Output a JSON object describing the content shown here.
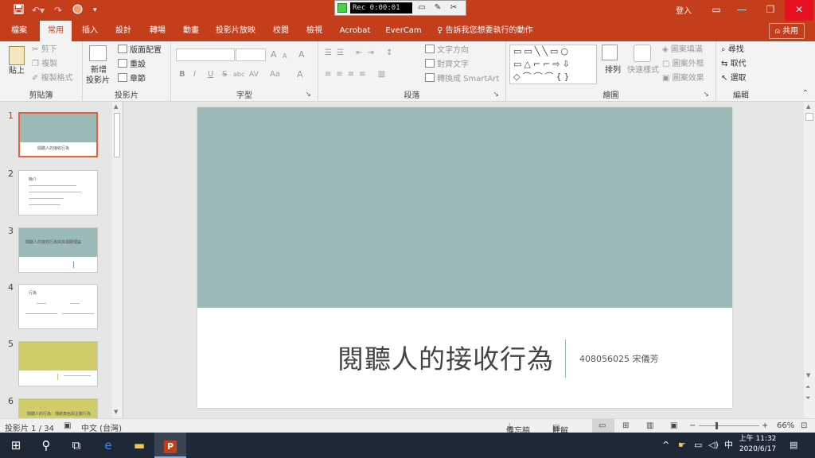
{
  "titlebar": {
    "save_icon": "save-icon",
    "undo_icon": "undo-icon",
    "redo_icon": "redo-icon",
    "login_label": "登入",
    "recorder": {
      "time": "Rec 0:00:01"
    }
  },
  "tabs": [
    {
      "label": "檔案"
    },
    {
      "label": "常用"
    },
    {
      "label": "插入"
    },
    {
      "label": "設計"
    },
    {
      "label": "轉場"
    },
    {
      "label": "動畫"
    },
    {
      "label": "投影片放映"
    },
    {
      "label": "校閱"
    },
    {
      "label": "檢視"
    },
    {
      "label": "Acrobat"
    },
    {
      "label": "EverCam"
    }
  ],
  "tell_me": "告訴我您想要執行的動作",
  "share_label": "共用",
  "ribbon": {
    "clipboard": {
      "paste": "貼上",
      "cut": "剪下",
      "copy": "複製",
      "format_painter": "複製格式",
      "label": "剪貼簿"
    },
    "slides": {
      "new_slide": "新增",
      "new_slide2": "投影片",
      "layout": "版面配置",
      "reset": "重設",
      "section": "章節",
      "label": "投影片"
    },
    "font": {
      "label": "字型",
      "bold": "B",
      "italic": "I",
      "underline": "U",
      "strike": "S",
      "shadow": "abc",
      "spacing": "AV",
      "case": "Aa",
      "color": "A",
      "grow": "A",
      "shrink": "A",
      "clear": "A"
    },
    "paragraph": {
      "text_direction": "文字方向",
      "align_text": "對齊文字",
      "smartart": "轉換成 SmartArt",
      "label": "段落"
    },
    "drawing": {
      "arrange": "排列",
      "quick_styles": "快速樣式",
      "fill": "圖案填滿",
      "outline": "圖案外框",
      "effects": "圖案效果",
      "label": "繪圖"
    },
    "editing": {
      "find": "尋找",
      "replace": "取代",
      "select": "選取",
      "label": "編輯"
    }
  },
  "thumbnails": [
    {
      "num": "1",
      "text": "閱聽人的接收行為"
    },
    {
      "num": "2",
      "text": "簡介"
    },
    {
      "num": "3",
      "text": "閱聽人的接收行為與其相關理論"
    },
    {
      "num": "4",
      "text": "行為"
    },
    {
      "num": "5",
      "text": ""
    },
    {
      "num": "6",
      "text": "閱聽人的行為：傳統角色與主動行為"
    }
  ],
  "slide": {
    "title": "閱聽人的接收行為",
    "subtitle": "408056025 宋儀芳",
    "band_color": "#9bb9b7"
  },
  "status": {
    "slide_counter": "投影片 1 / 34",
    "language": "中文 (台灣)",
    "notes": "備忘稿",
    "comments": "註解",
    "zoom": "66%"
  },
  "taskbar": {
    "time": "上午 11:32",
    "date": "2020/6/17",
    "ime": "中"
  },
  "colors": {
    "accent": "#c43e1c",
    "taskbar": "#1f2836",
    "selected_thumb": "#e0633a"
  }
}
